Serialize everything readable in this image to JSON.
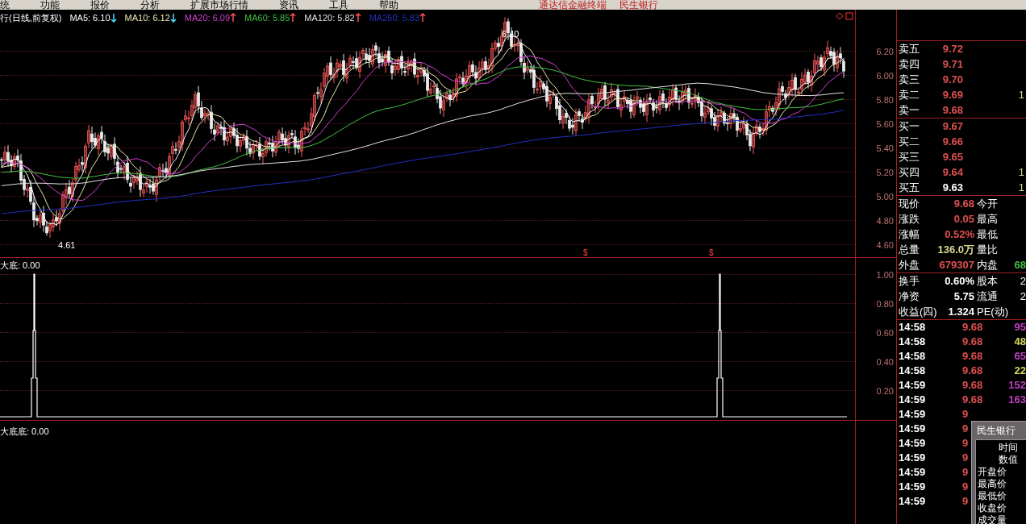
{
  "menu": [
    "统",
    "功能",
    "报价",
    "分析",
    "扩展市场行情",
    "资讯",
    "工具",
    "帮助"
  ],
  "title_bar": {
    "app": "通达信金融终端",
    "stock": "民生银行"
  },
  "legend": {
    "title": "行(日线,前复权)",
    "items": [
      {
        "label": "MA5: 6.10",
        "rising": false,
        "color": "#ffffff"
      },
      {
        "label": "MA10: 6.12",
        "rising": false,
        "color": "#e8e8b0"
      },
      {
        "label": "MA20: 6.09",
        "rising": true,
        "color": "#d040d0"
      },
      {
        "label": "MA60: 5.85",
        "rising": true,
        "color": "#40c040"
      },
      {
        "label": "MA120: 5.82",
        "rising": true,
        "color": "#e0e0e0"
      },
      {
        "label": "MA250: 5.83",
        "rising": true,
        "color": "#2030c0"
      }
    ]
  },
  "main_chart": {
    "high_label": "6.40",
    "low_label": "4.61",
    "markers": [
      "$",
      "$"
    ],
    "price_ticks": [
      "6.20",
      "6.00",
      "5.80",
      "5.60",
      "5.40",
      "5.20",
      "5.00",
      "4.80",
      "4.60"
    ]
  },
  "indicator": {
    "title": "大底: 0.00",
    "ticks": [
      "1.00",
      "0.80",
      "0.60",
      "0.40",
      "0.20"
    ]
  },
  "lower_indicator": {
    "title": "大底底: 0.00"
  },
  "order_book": [
    {
      "label": "卖五",
      "price": "9.72",
      "emphasis": false
    },
    {
      "label": "卖四",
      "price": "9.71",
      "emphasis": false
    },
    {
      "label": "卖三",
      "price": "9.70",
      "emphasis": false
    },
    {
      "label": "卖二",
      "price": "9.69",
      "volume": "1",
      "emphasis": false
    },
    {
      "label": "卖一",
      "price": "9.68",
      "emphasis": false
    },
    {
      "label": "买一",
      "price": "9.67",
      "emphasis": false
    },
    {
      "label": "买二",
      "price": "9.66",
      "emphasis": false
    },
    {
      "label": "买三",
      "price": "9.65",
      "emphasis": false
    },
    {
      "label": "买四",
      "price": "9.64",
      "volume": "1",
      "emphasis": false
    },
    {
      "label": "买五",
      "price": "9.63",
      "volume": "1",
      "emphasis": true
    }
  ],
  "quote": [
    {
      "label": "现价",
      "value": "9.68",
      "color": "#e05050",
      "side": {
        "label": "今开"
      }
    },
    {
      "label": "涨跌",
      "value": "0.05",
      "color": "#e05050",
      "side": {
        "label": "最高"
      }
    },
    {
      "label": "涨幅",
      "value": "0.52%",
      "color": "#e05050",
      "side": {
        "label": "最低"
      }
    },
    {
      "label": "总量",
      "value": "136.0万",
      "color": "#d8d890",
      "side": {
        "label": "量比"
      }
    },
    {
      "label": "外盘",
      "value": "679307",
      "color": "#e05050",
      "side": {
        "label": "内盘",
        "value": "68",
        "color": "#40c040"
      }
    }
  ],
  "finance": [
    {
      "label": "换手",
      "value": "0.60%",
      "label2": "股本",
      "value2": "2"
    },
    {
      "label": "净资",
      "value": "5.75",
      "label2": "流通",
      "value2": "2"
    },
    {
      "label": "收益(四)",
      "value": "1.324",
      "label2": "PE(动)"
    }
  ],
  "ticks": [
    {
      "time": "14:58",
      "price": "9.68",
      "volume": "95",
      "color": "#c040c0"
    },
    {
      "time": "14:58",
      "price": "9.68",
      "volume": "48",
      "color": "#d8d860"
    },
    {
      "time": "14:58",
      "price": "9.68",
      "volume": "65",
      "color": "#c040c0"
    },
    {
      "time": "14:58",
      "price": "9.68",
      "volume": "22",
      "color": "#d8d860"
    },
    {
      "time": "14:59",
      "price": "9.68",
      "volume": "152",
      "color": "#c040c0"
    },
    {
      "time": "14:59",
      "price": "9.68",
      "volume": "163",
      "color": "#c040c0"
    },
    {
      "time": "14:59",
      "price": "9"
    },
    {
      "time": "14:59",
      "price": "9"
    },
    {
      "time": "14:59",
      "price": "9"
    },
    {
      "time": "14:59",
      "price": "9"
    },
    {
      "time": "14:59",
      "price": "9"
    },
    {
      "time": "14:59",
      "price": "9"
    },
    {
      "time": "14:59",
      "price": "9"
    }
  ],
  "popup": {
    "title": "民生银行",
    "items": [
      "时间",
      "数值",
      "开盘价",
      "最高价",
      "最低价",
      "收盘价",
      "成交量"
    ]
  }
}
